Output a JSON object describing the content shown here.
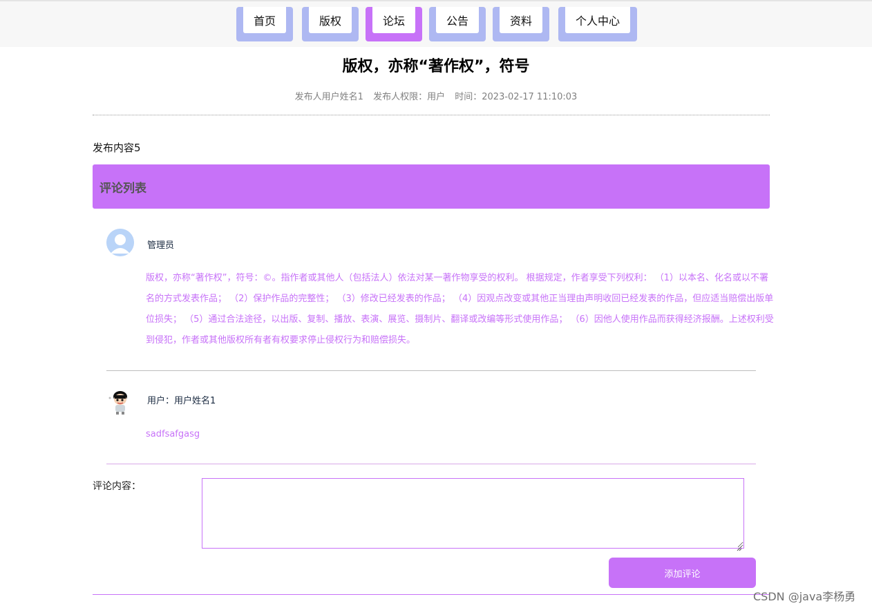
{
  "nav": {
    "tabs": [
      {
        "label": "首页",
        "active": false
      },
      {
        "label": "版权",
        "active": false
      },
      {
        "label": "论坛",
        "active": true
      },
      {
        "label": "公告",
        "active": false
      },
      {
        "label": "资料",
        "active": false
      },
      {
        "label": "个人中心",
        "active": false
      }
    ]
  },
  "post": {
    "title": "版权，亦称“著作权”，符号",
    "publisher": "发布人用户姓名1",
    "permission": "发布人权限：用户",
    "time": "时间：2023-02-17 11:10:03",
    "content": "发布内容5"
  },
  "comments": {
    "header": "评论列表",
    "items": [
      {
        "author": "管理员",
        "avatar_icon": "default-user-avatar-icon",
        "text": "版权，亦称“著作权”，符号：©。指作者或其他人（包括法人）依法对某一著作物享受的权利。 根据规定，作者享受下列权利： （1）以本名、化名或以不署名的方式发表作品； （2）保护作品的完整性； （3）修改已经发表的作品； （4）因观点改变或其他正当理由声明收回已经发表的作品，但应适当赔偿出版单位损失； （5）通过合法途径，以出版、复制、播放、表演、展览、摄制片、翻译或改编等形式使用作品； （6）因他人使用作品而获得经济报酬。上述权利受到侵犯，作者或其他版权所有者有权要求停止侵权行为和赔偿损失。"
      },
      {
        "author": "用户：用户姓名1",
        "avatar_icon": "cartoon-boy-avatar-icon",
        "text": "sadfsafgasg"
      }
    ]
  },
  "form": {
    "label": "评论内容：",
    "value": "",
    "submit_label": "添加评论"
  },
  "watermark": "CSDN @java李杨勇",
  "colors": {
    "accent": "#c772f8",
    "tab_inactive": "#aeb8f2",
    "topbar": "#f7f7f7"
  }
}
